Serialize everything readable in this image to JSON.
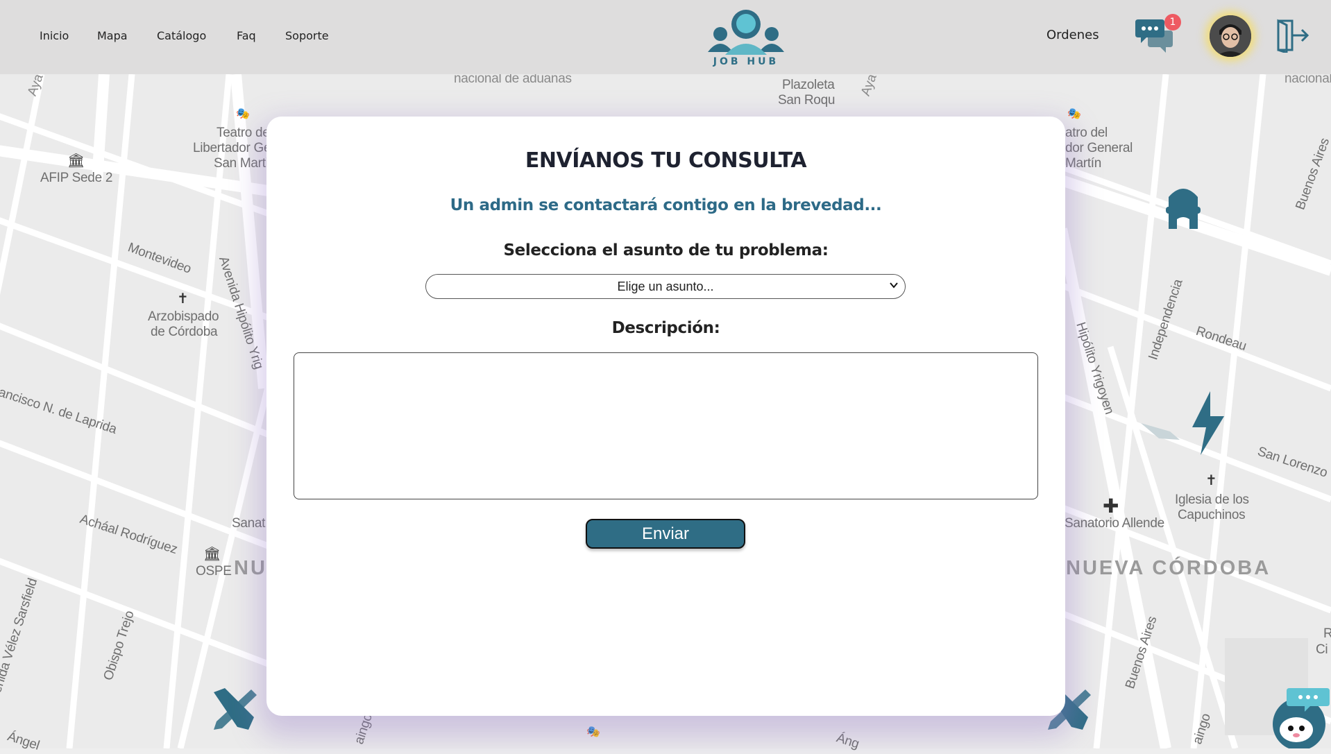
{
  "nav": {
    "links": [
      "Inicio",
      "Mapa",
      "Catálogo",
      "Faq",
      "Soporte"
    ],
    "logo_text": "JOB HUB",
    "orders_label": "Ordenes",
    "chat_badge_count": "1"
  },
  "form": {
    "title": "ENVÍANOS TU CONSULTA",
    "subtitle": "Un admin se contactará contigo en la brevedad...",
    "subject_label": "Selecciona el asunto de tu problema:",
    "subject_value": "Elige un asunto...",
    "description_label": "Descripción:",
    "description_value": "",
    "submit_label": "Enviar"
  },
  "map": {
    "labels": [
      "nacional de aduanas",
      "Plazoleta",
      "San Roqu",
      "Aya",
      "Aya",
      "nacional",
      "Teatro de",
      "Libertador Ge",
      "San Marti",
      "AFIP Sede 2",
      "Montevideo",
      "Avenida Hipólito Yrig",
      "Arzobispado",
      "de Córdoba",
      "ancisco N. de Laprida",
      "Acháal Rodríguez",
      "Sanat",
      "OSPE",
      "NU",
      "venida Vélez Sarsfield",
      "Obispo Trejo",
      "atro del",
      "dor General",
      "Martín",
      "Buenos Aires",
      "Independencia",
      "Rondeau",
      "Hipólito Yrigoyen",
      "San Lorenzo",
      "Iglesia de los",
      "Capuchinos",
      "Sanatorio Allende",
      "NUEVA CÓRDOBA",
      "Buenos Aires",
      "aingo",
      "aingo",
      "Ángel",
      "Áng",
      "R",
      "Ci"
    ],
    "colors": {
      "road": "#ffffff",
      "block": "#e9e9e9",
      "accent": "#2f6d85",
      "badge": "#ee5a62"
    }
  }
}
